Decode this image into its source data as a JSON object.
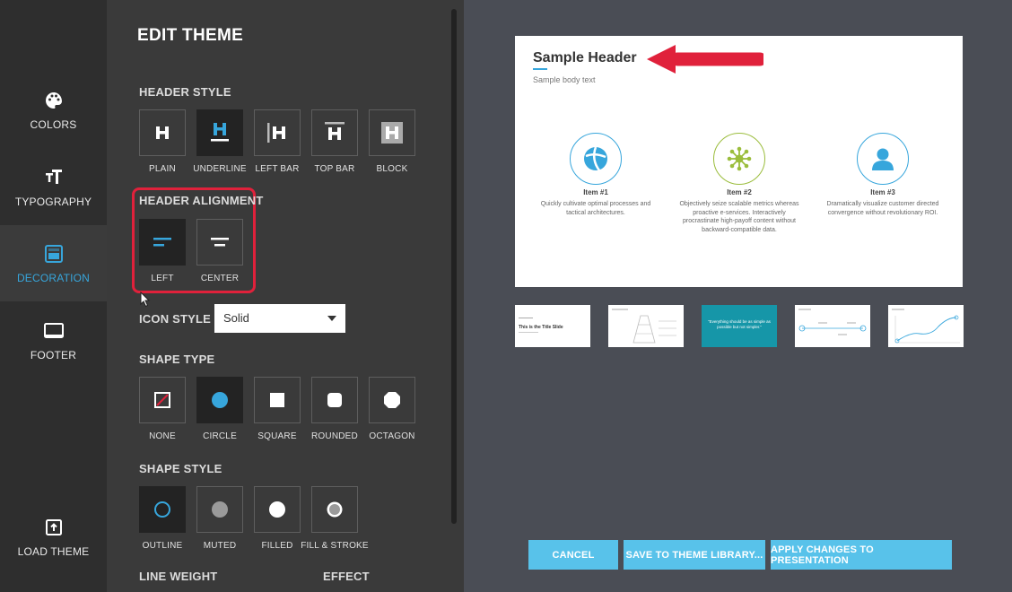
{
  "nav": {
    "colors": "COLORS",
    "typography": "TYPOGRAPHY",
    "decoration": "DECORATION",
    "footer": "FOOTER",
    "load_theme": "LOAD THEME"
  },
  "panel": {
    "title": "EDIT THEME",
    "header_style": {
      "title": "HEADER STYLE",
      "options": [
        "PLAIN",
        "UNDERLINE",
        "LEFT BAR",
        "TOP BAR",
        "BLOCK"
      ],
      "selected": "UNDERLINE"
    },
    "header_alignment": {
      "title": "HEADER ALIGNMENT",
      "options": [
        "LEFT",
        "CENTER"
      ],
      "selected": "LEFT"
    },
    "icon_style": {
      "title": "ICON STYLE",
      "value": "Solid"
    },
    "shape_type": {
      "title": "SHAPE TYPE",
      "options": [
        "NONE",
        "CIRCLE",
        "SQUARE",
        "ROUNDED",
        "OCTAGON"
      ],
      "selected": "CIRCLE"
    },
    "shape_style": {
      "title": "SHAPE STYLE",
      "options": [
        "OUTLINE",
        "MUTED",
        "FILLED",
        "FILL & STROKE"
      ],
      "selected": "OUTLINE"
    },
    "line_weight": {
      "title": "LINE WEIGHT"
    },
    "effect": {
      "title": "EFFECT"
    }
  },
  "slide": {
    "header": "Sample Header",
    "body": "Sample body text",
    "items": [
      {
        "title": "Item #1",
        "desc": "Quickly cultivate optimal processes and tactical architectures.",
        "color": "#37a6dc",
        "icon": "beach-ball-icon"
      },
      {
        "title": "Item #2",
        "desc": "Objectively seize scalable metrics whereas proactive e-services. Interactively procrastinate high-payoff content without backward-compatible data.",
        "color": "#9bbd3c",
        "icon": "network-icon"
      },
      {
        "title": "Item #3",
        "desc": "Dramatically visualize customer directed convergence without revolutionary ROI.",
        "color": "#37a6dc",
        "icon": "person-icon"
      }
    ]
  },
  "thumbnails": {
    "t1_title": "This is the Title Slide",
    "t3_text": "\"Everything should be as simple as possible but not simpler.\""
  },
  "buttons": {
    "cancel": "CANCEL",
    "save": "SAVE TO THEME LIBRARY...",
    "apply": "APPLY CHANGES TO PRESENTATION"
  },
  "colors": {
    "accent": "#37a6dc",
    "highlight": "#e0213b",
    "button": "#58c2ea"
  }
}
